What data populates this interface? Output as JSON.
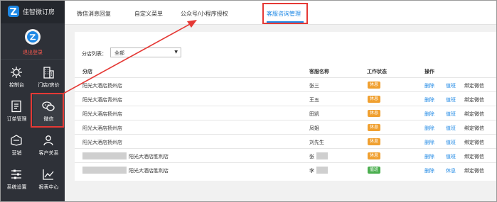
{
  "app": {
    "name": "佳智微订房"
  },
  "user": {
    "logout_label": "退出登录"
  },
  "sidebar": {
    "items": [
      {
        "label": "控制台",
        "icon": "dashboard-icon"
      },
      {
        "label": "门店/房价",
        "icon": "building-icon"
      },
      {
        "label": "订单管理",
        "icon": "order-icon"
      },
      {
        "label": "微信",
        "icon": "wechat-icon"
      },
      {
        "label": "营销",
        "icon": "sale-tag-icon"
      },
      {
        "label": "客户关系",
        "icon": "customers-icon"
      },
      {
        "label": "系统设置",
        "icon": "settings-sliders-icon"
      },
      {
        "label": "报表中心",
        "icon": "chart-icon"
      }
    ],
    "active_index": 3
  },
  "tabs": [
    {
      "label": "微信消息回复"
    },
    {
      "label": "自定义菜单"
    },
    {
      "label": "公众号/小程序授权"
    },
    {
      "label": "客服咨询管理"
    }
  ],
  "active_tab": 3,
  "filter": {
    "label": "分店列表：",
    "selected": "全部"
  },
  "table": {
    "headers": [
      "分店",
      "客服名称",
      "工作状态",
      "操作"
    ],
    "rows": [
      {
        "store": "阳光大酒店扬州店",
        "agent": "张三",
        "status": "休息",
        "status_kind": "rest",
        "op1": "删除",
        "op2": "值班",
        "op3": "绑定微信"
      },
      {
        "store": "阳光大酒店青州店",
        "agent": "王五",
        "status": "休息",
        "status_kind": "rest",
        "op1": "删除",
        "op2": "值班",
        "op3": "绑定微信"
      },
      {
        "store": "阳光大酒店扬州店",
        "agent": "田凯",
        "status": "休息",
        "status_kind": "rest",
        "op1": "删除",
        "op2": "值班",
        "op3": "绑定微信"
      },
      {
        "store": "阳光大酒店扬州店",
        "agent": "凤姐",
        "status": "休息",
        "status_kind": "rest",
        "op1": "删除",
        "op2": "值班",
        "op3": "绑定微信"
      },
      {
        "store": "阳光大酒店扬州店",
        "agent": "刘先生",
        "status": "休息",
        "status_kind": "rest",
        "op1": "删除",
        "op2": "值班",
        "op3": "绑定微信"
      },
      {
        "store": "阳光大酒店胜利店",
        "agent": "张",
        "status": "休息",
        "status_kind": "rest",
        "op1": "删除",
        "op2": "值班",
        "op3": "绑定微信"
      },
      {
        "store": "阳光大酒店胜利店",
        "agent": "李",
        "status": "值班",
        "status_kind": "duty",
        "op1": "删除",
        "op2": "休息",
        "op3": "绑定微信"
      }
    ]
  },
  "colors": {
    "sidebar_bg": "#2e3138",
    "accent": "#1e88e5",
    "highlight": "#e53935",
    "status_rest": "#f0a030",
    "status_duty": "#4caf50",
    "logout": "#ff5a4f"
  }
}
